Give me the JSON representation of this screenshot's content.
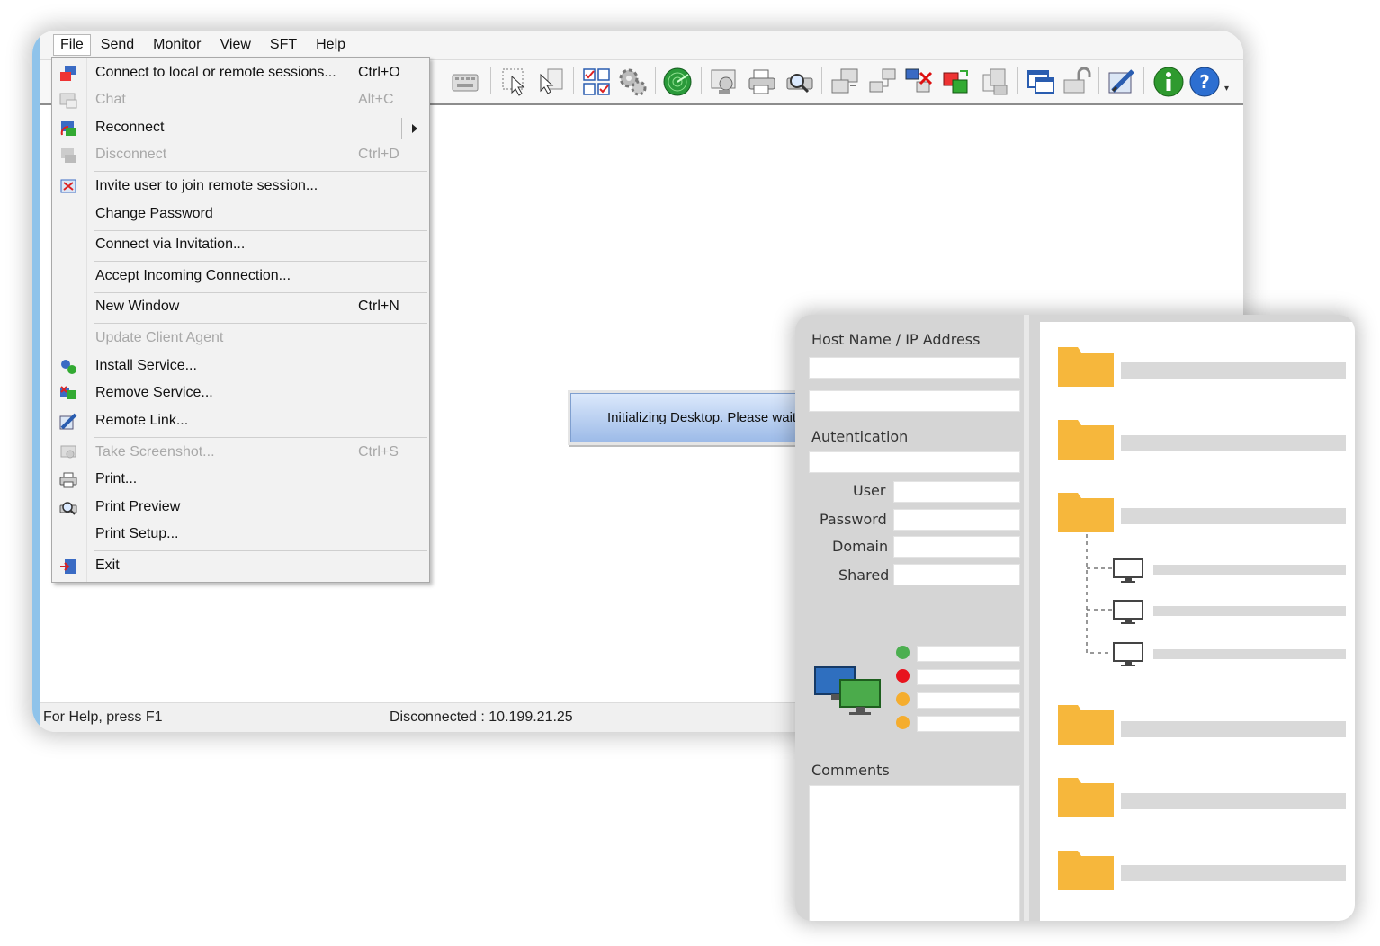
{
  "menubar": {
    "items": [
      "File",
      "Send",
      "Monitor",
      "View",
      "SFT",
      "Help"
    ]
  },
  "file_menu": {
    "items": [
      {
        "label": "Connect to local or remote sessions...",
        "shortcut": "Ctrl+O",
        "icon": "connect-icon",
        "enabled": true
      },
      {
        "label": "Chat",
        "shortcut": "Alt+C",
        "icon": "chat-icon",
        "enabled": false
      },
      {
        "label": "Reconnect",
        "shortcut": "",
        "icon": "reconnect-icon",
        "enabled": true,
        "submenu": true
      },
      {
        "label": "Disconnect",
        "shortcut": "Ctrl+D",
        "icon": "disconnect-icon",
        "enabled": false
      },
      {
        "label": "Invite user to join remote session...",
        "shortcut": "",
        "icon": "invite-icon",
        "enabled": true
      },
      {
        "label": "Change Password",
        "shortcut": "",
        "icon": "",
        "enabled": true
      },
      {
        "label": "Connect via Invitation...",
        "shortcut": "",
        "icon": "",
        "enabled": true
      },
      {
        "label": "Accept Incoming Connection...",
        "shortcut": "",
        "icon": "",
        "enabled": true
      },
      {
        "label": "New Window",
        "shortcut": "Ctrl+N",
        "icon": "",
        "enabled": true
      },
      {
        "label": "Update Client Agent",
        "shortcut": "",
        "icon": "",
        "enabled": false
      },
      {
        "label": "Install Service...",
        "shortcut": "",
        "icon": "install-service-icon",
        "enabled": true
      },
      {
        "label": "Remove Service...",
        "shortcut": "",
        "icon": "remove-service-icon",
        "enabled": true
      },
      {
        "label": "Remote Link...",
        "shortcut": "",
        "icon": "remote-link-icon",
        "enabled": true
      },
      {
        "label": "Take Screenshot...",
        "shortcut": "Ctrl+S",
        "icon": "screenshot-icon",
        "enabled": false
      },
      {
        "label": "Print...",
        "shortcut": "",
        "icon": "print-icon",
        "enabled": true
      },
      {
        "label": "Print Preview",
        "shortcut": "",
        "icon": "print-preview-icon",
        "enabled": true
      },
      {
        "label": "Print Setup...",
        "shortcut": "",
        "icon": "",
        "enabled": true
      },
      {
        "label": "Exit",
        "shortcut": "",
        "icon": "exit-icon",
        "enabled": true
      }
    ]
  },
  "toolbar": {
    "icons": [
      "keyboard-icon",
      "select-icon",
      "pointer-icon",
      "checklist-icon",
      "settings-gear-icon",
      "radar-icon",
      "screenshot-icon",
      "print-icon",
      "print-preview-icon",
      "connect-icon",
      "network-icon",
      "disconnect-network-icon",
      "transfer-icon",
      "file-transfer-icon",
      "window-icon",
      "lock-icon",
      "remote-link-icon",
      "info-icon",
      "help-icon"
    ]
  },
  "dialog": {
    "message": "Initializing Desktop. Please wait."
  },
  "status": {
    "help": "For Help, press F1",
    "connection": "Disconnected : 10.199.21.25"
  },
  "mockup": {
    "host_label": "Host Name / IP Address",
    "auth_label": "Autentication",
    "user_label": "User",
    "password_label": "Password",
    "domain_label": "Domain",
    "shared_label": "Shared",
    "comments_label": "Comments",
    "status_colors": [
      "#4caf50",
      "#e8141e",
      "#f5ad2e",
      "#f5ad2e"
    ],
    "folder_color": "#f6b73c"
  }
}
